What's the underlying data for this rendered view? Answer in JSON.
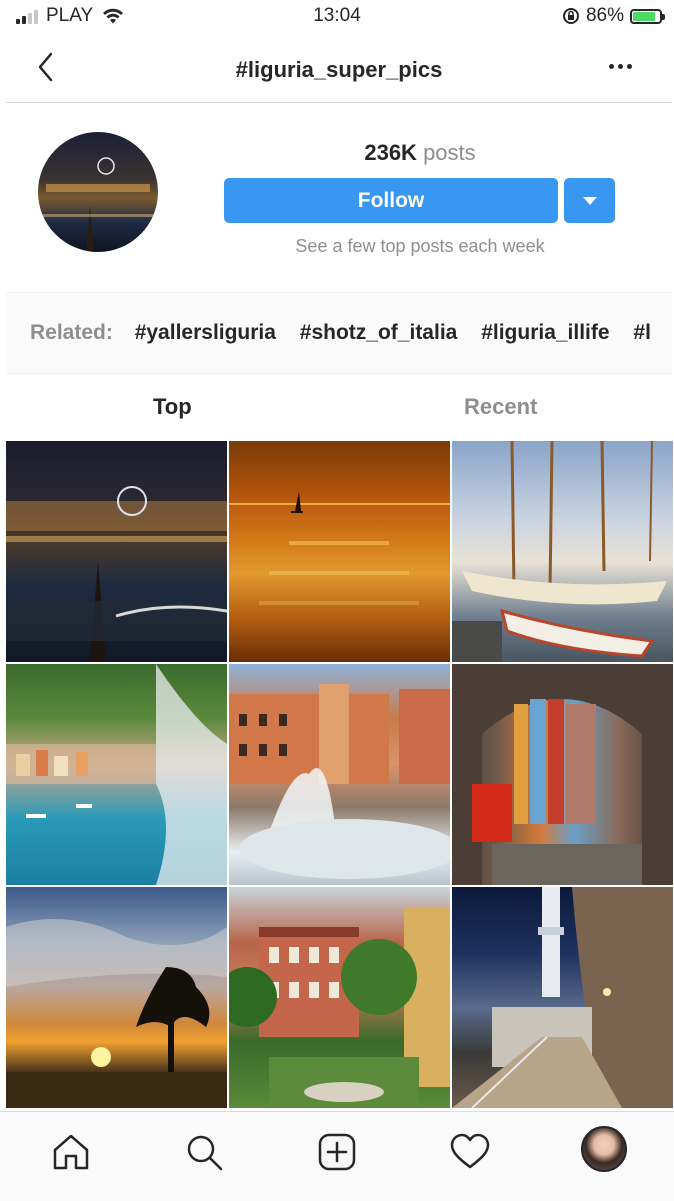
{
  "status_bar": {
    "carrier": "PLAY",
    "time": "13:04",
    "battery_percent": "86%",
    "battery_level": 0.86,
    "icons": [
      "signal-icon",
      "wifi-icon",
      "rotation-lock-icon",
      "battery-charging-icon"
    ]
  },
  "header": {
    "title": "#liguria_super_pics",
    "back_icon": "chevron-left-icon",
    "more_icon": "more-horizontal-icon"
  },
  "profile": {
    "posts_count": "236K",
    "posts_label": "posts",
    "follow_label": "Follow",
    "dropdown_icon": "caret-down-icon",
    "subtext": "See a few top posts each week"
  },
  "related": {
    "label": "Related:",
    "tags": [
      "#yallersliguria",
      "#shotz_of_italia",
      "#liguria_illife",
      "#l"
    ]
  },
  "tabs": [
    {
      "label": "Top",
      "active": true
    },
    {
      "label": "Recent",
      "active": false
    }
  ],
  "grid": {
    "photos": [
      {
        "subject": "genoa-harbor-night"
      },
      {
        "subject": "golden-sunset-sea-sailboat"
      },
      {
        "subject": "moored-sailboats"
      },
      {
        "subject": "portofino-bay"
      },
      {
        "subject": "piazza-fountain"
      },
      {
        "subject": "arch-alley-colorful-houses"
      },
      {
        "subject": "tree-silhouette-sunset"
      },
      {
        "subject": "palazzo-garden"
      },
      {
        "subject": "lighthouse-walkway-night"
      }
    ]
  },
  "bottom_nav": {
    "items": [
      "home-icon",
      "search-icon",
      "add-post-icon",
      "heart-icon",
      "profile-avatar"
    ]
  }
}
